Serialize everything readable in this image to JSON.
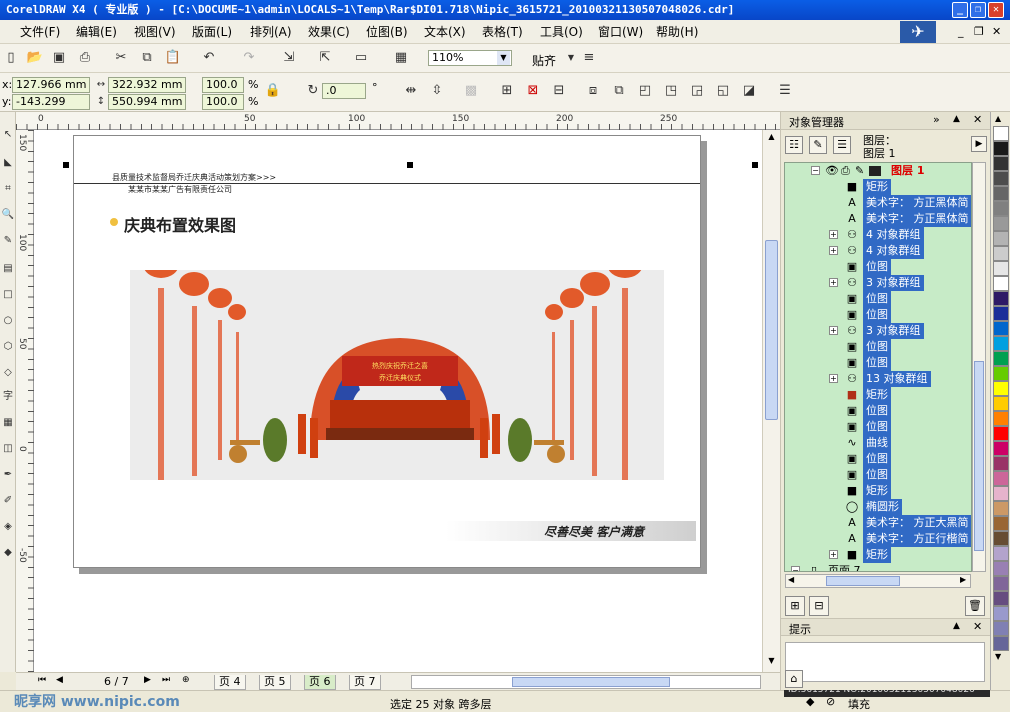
{
  "window": {
    "title": "CorelDRAW X4 ( 专业版 ) - [C:\\DOCUME~1\\admin\\LOCALS~1\\Temp\\Rar$DI01.718\\Nipic_3615721_20100321130507048026.cdr]",
    "watermark_top": "昵图网 www.nipic.com"
  },
  "menu": [
    "文件(F)",
    "编辑(E)",
    "视图(V)",
    "版面(L)",
    "排列(A)",
    "效果(C)",
    "位图(B)",
    "文本(X)",
    "表格(T)",
    "工具(O)",
    "窗口(W)",
    "帮助(H)"
  ],
  "toolbar": {
    "zoom": "110%",
    "snap_label": "贴齐"
  },
  "property_bar": {
    "x": "127.966 mm",
    "y": "-143.299 mm",
    "width": "322.932 mm",
    "height": "550.994 mm",
    "scale_x": "100.0",
    "scale_y": "100.0",
    "pct": "%",
    "rotation": ".0",
    "deg": "°",
    "x_label": "x:",
    "y_label": "y:"
  },
  "ruler_h": [
    "50",
    "100",
    "150",
    "200",
    "250"
  ],
  "ruler_v": [
    "150",
    "100",
    "50",
    "0",
    "-50"
  ],
  "ruler_origin": "0",
  "page": {
    "header_line1": "县质量技术监督局乔迁庆典活动策划方案>>>",
    "header_line2": "某某市某某广告有限责任公司",
    "section_title": "庆典布置效果图",
    "arch_text1": "热烈庆祝乔迁之喜",
    "arch_text2": "乔迁庆典仪式",
    "slogan": "尽善尽美  客户满意"
  },
  "page_nav": {
    "counter": "6 / 7",
    "tabs": [
      "页 4",
      "页 5",
      "页 6",
      "页 7"
    ]
  },
  "status": {
    "selection": "选定 25 对象 跨多层",
    "fill_label": "填充",
    "watermark_id": "ID:3615721 NO:20100321130507048026",
    "watermark_logo": "昵享网 www.nipic.com"
  },
  "docker": {
    "title": "对象管理器",
    "layer_label_1": "图层：",
    "layer_label_2": "图层 1",
    "tree": [
      {
        "icon": "layer",
        "label": "图层 1",
        "expand": "minus"
      },
      {
        "icon": "rect",
        "label": "矩形"
      },
      {
        "icon": "text",
        "label": "美术字： 方正黑体简"
      },
      {
        "icon": "text",
        "label": "美术字： 方正黑体简"
      },
      {
        "icon": "group",
        "label": "4 对象群组",
        "expand": "plus"
      },
      {
        "icon": "group",
        "label": "4 对象群组",
        "expand": "plus"
      },
      {
        "icon": "bitmap",
        "label": "位图"
      },
      {
        "icon": "group",
        "label": "3 对象群组",
        "expand": "plus"
      },
      {
        "icon": "bitmap",
        "label": "位图"
      },
      {
        "icon": "bitmap",
        "label": "位图"
      },
      {
        "icon": "group",
        "label": "3 对象群组",
        "expand": "plus"
      },
      {
        "icon": "bitmap",
        "label": "位图"
      },
      {
        "icon": "bitmap",
        "label": "位图"
      },
      {
        "icon": "group",
        "label": "13 对象群组",
        "expand": "plus"
      },
      {
        "icon": "rect",
        "label": "矩形"
      },
      {
        "icon": "bitmap",
        "label": "位图"
      },
      {
        "icon": "bitmap",
        "label": "位图"
      },
      {
        "icon": "curve",
        "label": "曲线"
      },
      {
        "icon": "bitmap",
        "label": "位图"
      },
      {
        "icon": "bitmap",
        "label": "位图"
      },
      {
        "icon": "rect",
        "label": "矩形"
      },
      {
        "icon": "ellipse",
        "label": "椭圆形"
      },
      {
        "icon": "text",
        "label": "美术字： 方正大黑简"
      },
      {
        "icon": "text",
        "label": "美术字： 方正行楷简"
      },
      {
        "icon": "rect",
        "label": "矩形",
        "expand": "plus"
      },
      {
        "icon": "page",
        "label": "页面 7",
        "expand": "minus"
      }
    ],
    "hint_title": "提示"
  },
  "palette": [
    "#ffffff",
    "#1a1a1a",
    "#333333",
    "#4d4d4d",
    "#666666",
    "#808080",
    "#999999",
    "#b3b3b3",
    "#cccccc",
    "#e6e6e6",
    "#ffffff",
    "#2e1a66",
    "#1a2e99",
    "#0066cc",
    "#00a0e0",
    "#00a050",
    "#66cc00",
    "#ffff00",
    "#ffcc00",
    "#ff8000",
    "#ff0000",
    "#cc0066",
    "#993366",
    "#cc6699",
    "#e6b3cc",
    "#cc9966",
    "#996633",
    "#664d33",
    "#b3a3cc",
    "#9980b3",
    "#806699",
    "#664d80",
    "#9999cc",
    "#8080b3",
    "#666699"
  ],
  "colors": {
    "accent_selection": "#316ac5",
    "tree_bg": "#c7ebc7",
    "title_bar": "#0a5ee6"
  }
}
